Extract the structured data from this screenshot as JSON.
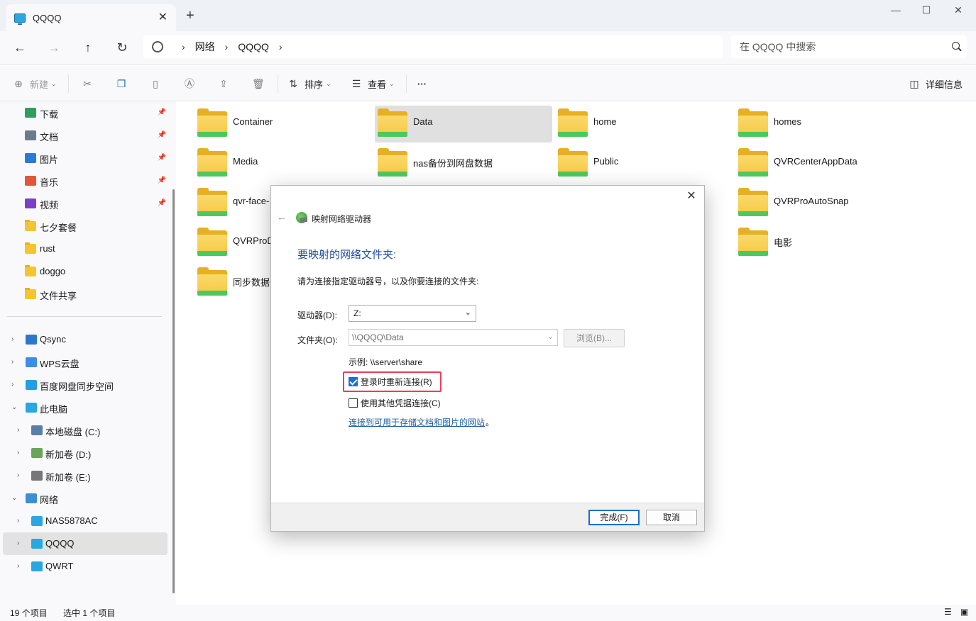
{
  "window": {
    "tab_title": "QQQQ",
    "tab_close": "✕",
    "new_tab": "+",
    "minimize": "—",
    "maximize": "☐",
    "close": "✕"
  },
  "nav": {
    "back": "←",
    "forward": "→",
    "up": "↑",
    "refresh": "↻"
  },
  "address": {
    "crumbs": [
      "网络",
      "QQQQ"
    ],
    "separator": "›"
  },
  "search": {
    "placeholder": "在 QQQQ 中搜索"
  },
  "toolbar": {
    "new_label": "新建",
    "sort_label": "排序",
    "view_label": "查看",
    "more_label": "···",
    "details_label": "详细信息"
  },
  "sidebar": {
    "quick_access": [
      {
        "label": "下载",
        "icon": "download-icon",
        "color": "#2f9d5f"
      },
      {
        "label": "文档",
        "icon": "document-icon",
        "color": "#6b7a8c"
      },
      {
        "label": "图片",
        "icon": "picture-icon",
        "color": "#2a7bd6"
      },
      {
        "label": "音乐",
        "icon": "music-icon",
        "color": "#e0573c"
      },
      {
        "label": "视频",
        "icon": "video-icon",
        "color": "#7b3fc4"
      },
      {
        "label": "七夕套餐",
        "icon": "folder-icon",
        "color": "#f4c531"
      },
      {
        "label": "rust",
        "icon": "folder-icon",
        "color": "#f4c531"
      },
      {
        "label": "doggo",
        "icon": "folder-icon",
        "color": "#f4c531"
      },
      {
        "label": "文件共享",
        "icon": "folder-icon",
        "color": "#f4c531"
      }
    ],
    "tree": [
      {
        "label": "Qsync",
        "icon": "qsync-icon",
        "color": "#2b77c9"
      },
      {
        "label": "WPS云盘",
        "icon": "cloud-icon",
        "color": "#3a8ee6"
      },
      {
        "label": "百度网盘同步空间",
        "icon": "baidu-icon",
        "color": "#2a9be0"
      },
      {
        "label": "此电脑",
        "icon": "computer-icon",
        "color": "#29a7e2"
      },
      {
        "label": "本地磁盘 (C:)",
        "icon": "drive-c-icon",
        "color": "#5a7fa6"
      },
      {
        "label": "新加卷 (D:)",
        "icon": "drive-d-icon",
        "color": "#6aa35a"
      },
      {
        "label": "新加卷 (E:)",
        "icon": "drive-e-icon",
        "color": "#777777"
      },
      {
        "label": "网络",
        "icon": "network-icon",
        "color": "#3b8fd2"
      },
      {
        "label": "NAS5878AC",
        "icon": "computer-icon",
        "color": "#29a7e2"
      },
      {
        "label": "QQQQ",
        "icon": "computer-icon",
        "color": "#29a7e2"
      },
      {
        "label": "QWRT",
        "icon": "computer-icon",
        "color": "#29a7e2"
      }
    ],
    "expander_collapsed": "›",
    "expander_expanded": "⌄"
  },
  "folders": [
    "Container",
    "Data",
    "home",
    "homes",
    "Media",
    "nas备份到网盘数据",
    "Public",
    "QVRCenterAppData",
    "qvr-face-",
    "",
    "",
    "QVRProAutoSnap",
    "QVRProD",
    "",
    "",
    "电影",
    "同步数据"
  ],
  "status": {
    "count": "19 个项目",
    "selected": "选中 1 个项目"
  },
  "dialog": {
    "close": "✕",
    "back": "←",
    "title": "映射网络驱动器",
    "heading": "要映射的网络文件夹:",
    "description": "请为连接指定驱动器号，以及你要连接的文件夹:",
    "drive_label": "驱动器(D):",
    "drive_value": "Z:",
    "folder_label": "文件夹(O):",
    "folder_value": "\\\\QQQQ\\Data",
    "browse_label": "浏览(B)...",
    "example": "示例: \\\\server\\share",
    "reconnect_label": "登录时重新连接(R)",
    "reconnect_checked": true,
    "other_creds_label": "使用其他凭据连接(C)",
    "other_creds_checked": false,
    "link_text": "连接到可用于存储文档和图片的网站",
    "link_suffix": "。",
    "finish_label": "完成(F)",
    "cancel_label": "取消"
  },
  "colors": {
    "accent": "#1c6fd1",
    "highlight": "#e83f5b",
    "heading_blue": "#1e4a9b"
  }
}
